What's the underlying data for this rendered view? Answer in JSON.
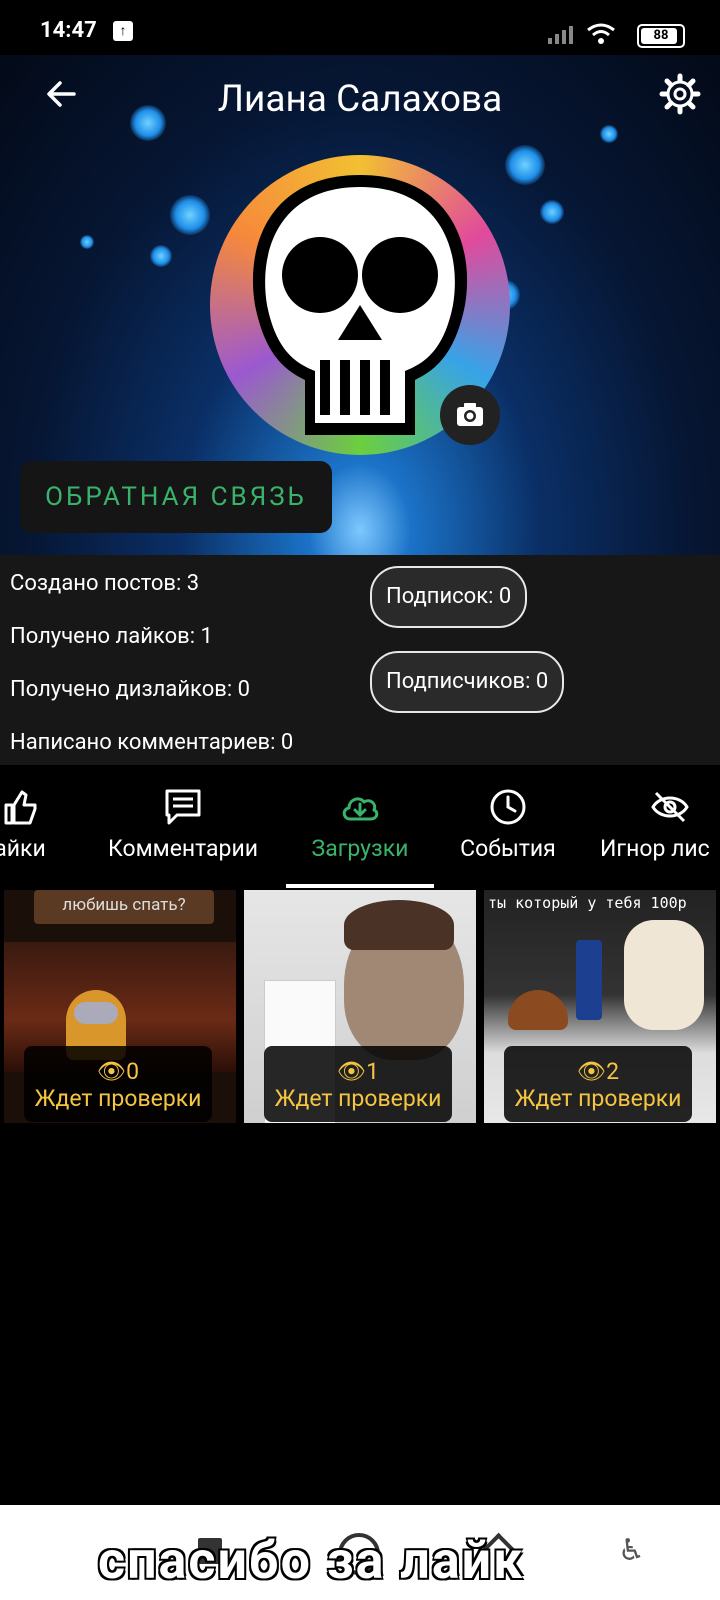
{
  "status_bar": {
    "time": "14:47",
    "battery": "88"
  },
  "header": {
    "title": "Лиана Салахова",
    "feedback_label": "ОБРАТНАЯ СВЯЗЬ"
  },
  "stats": {
    "posts": "Создано постов:  3",
    "likes": "Получено лайков:  1",
    "dislikes": "Получено дизлайков:  0",
    "comments": "Написано комментариев:  0",
    "subscriptions": "Подписок:  0",
    "subscribers": "Подписчиков:  0"
  },
  "tabs": [
    {
      "label": "Лайки",
      "visible": "айки",
      "icon": "thumb-up-icon"
    },
    {
      "label": "Комментарии",
      "icon": "comment-icon"
    },
    {
      "label": "Загрузки",
      "icon": "cloud-download-icon",
      "active": true
    },
    {
      "label": "События",
      "icon": "clock-icon"
    },
    {
      "label": "Игнор лис",
      "icon": "eye-off-icon"
    }
  ],
  "uploads": [
    {
      "caption": "любишь спать?",
      "views": "0",
      "status": "Ждет проверки"
    },
    {
      "caption": "",
      "views": "1",
      "status": "Ждет проверки"
    },
    {
      "caption": "ты который у тебя 100р",
      "views": "2",
      "status": "Ждет проверки"
    }
  ],
  "overlay": {
    "text": "спасибо  за  лайк"
  },
  "colors": {
    "accent": "#39b36b",
    "badge_text": "#f5c542"
  }
}
